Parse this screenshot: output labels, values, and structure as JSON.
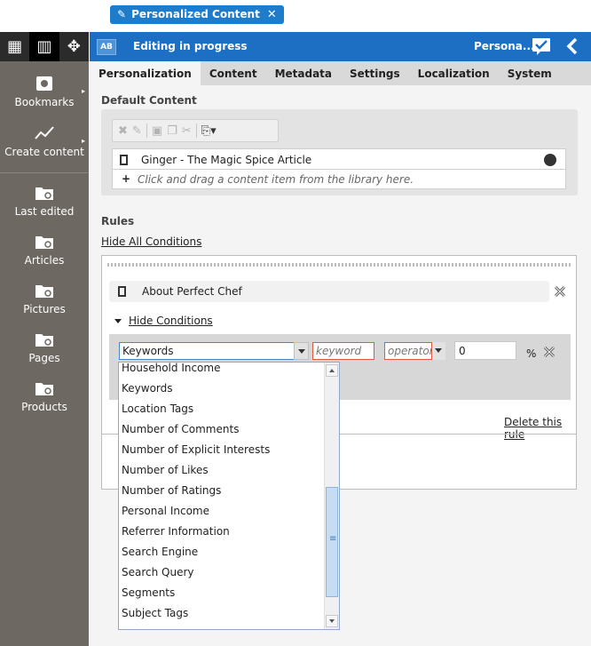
{
  "tag": {
    "label": "Personalized Content"
  },
  "sidebar": {
    "items": [
      {
        "label": "Bookmarks"
      },
      {
        "label": "Create content"
      },
      {
        "label": "Last edited"
      },
      {
        "label": "Articles"
      },
      {
        "label": "Pictures"
      },
      {
        "label": "Pages"
      },
      {
        "label": "Products"
      }
    ]
  },
  "header": {
    "badge": "AB",
    "title": "Editing in progress",
    "name": "Persona..."
  },
  "tabs": [
    "Personalization",
    "Content",
    "Metadata",
    "Settings",
    "Localization",
    "System"
  ],
  "default_content": {
    "heading": "Default Content",
    "item": "Ginger - The Magic Spice Article",
    "drop_hint": "Click and drag a content item from the library here."
  },
  "rules": {
    "heading": "Rules",
    "hide_all": "Hide All Conditions",
    "rule_item": "About Perfect Chef",
    "hide_conditions": "Hide Conditions",
    "condition": {
      "field_value": "Keywords",
      "keyword_placeholder": "keyword",
      "operator_placeholder": "operator",
      "value": "0",
      "unit": "%"
    },
    "delete_rule": "Delete this rule"
  },
  "dropdown": {
    "options": [
      "Household Income",
      "Keywords",
      "Location Tags",
      "Number of Comments",
      "Number of Explicit Interests",
      "Number of Likes",
      "Number of Ratings",
      "Personal Income",
      "Referrer Information",
      "Search Engine",
      "Search Query",
      "Segments",
      "Subject Tags"
    ]
  },
  "colors": {
    "accent": "#1d6fc4",
    "sidebar": "#6d6862",
    "error_border": "#e05a3a"
  }
}
